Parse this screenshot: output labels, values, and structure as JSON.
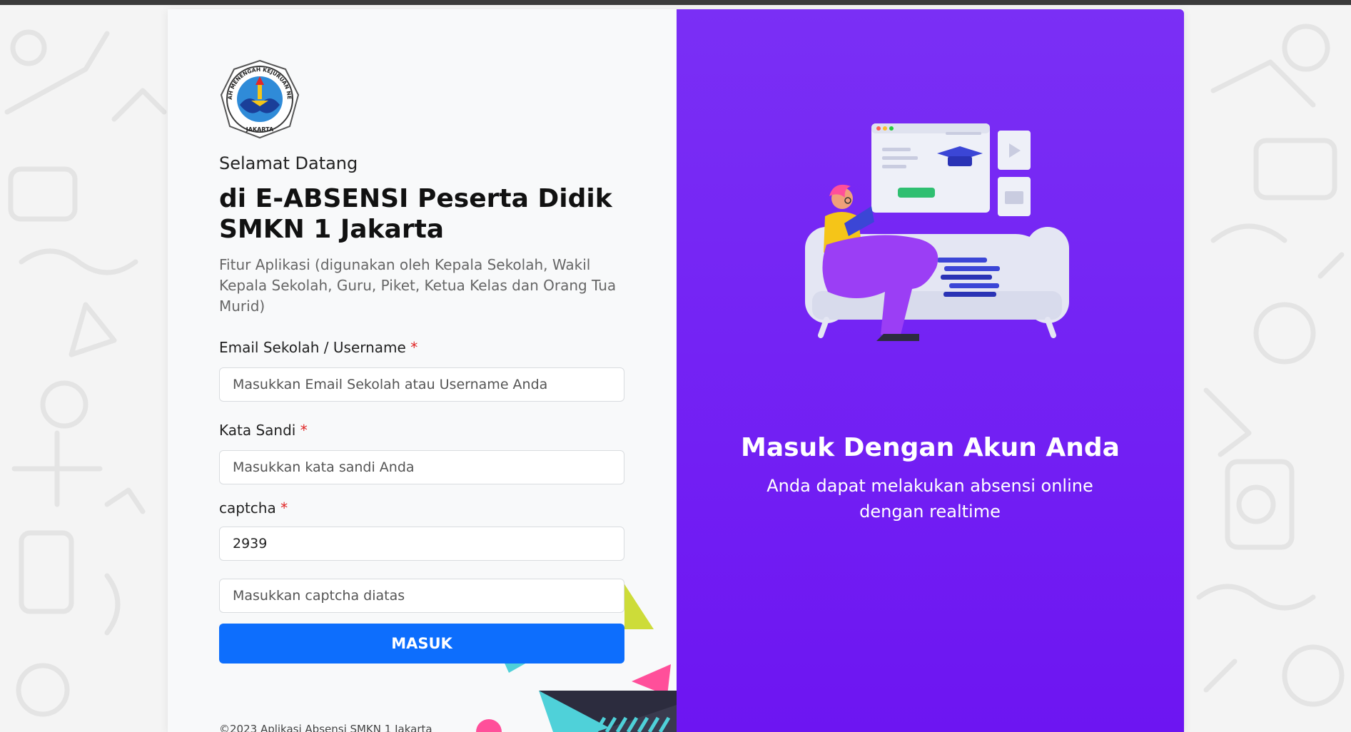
{
  "logo": {
    "ring_text": "SEKOLAH MENENGAH KEJURUAN NEGERI 1",
    "bottom_text": "JAKARTA"
  },
  "login": {
    "welcome": "Selamat Datang",
    "title_line1": "di E-ABSENSI Peserta Didik",
    "title_line2": "SMKN 1 Jakarta",
    "subtitle": "Fitur Aplikasi (digunakan oleh Kepala Sekolah, Wakil Kepala Sekolah, Guru, Piket, Ketua Kelas dan Orang Tua Murid)",
    "required_mark": "*",
    "email_label": "Email Sekolah / Username",
    "email_placeholder": "Masukkan Email Sekolah atau Username Anda",
    "password_label": "Kata Sandi",
    "password_placeholder": "Masukkan kata sandi Anda",
    "captcha_label": "captcha",
    "captcha_value": "2939",
    "captcha_placeholder": "Masukkan captcha diatas",
    "submit_label": "MASUK",
    "footer": "©2023 Aplikasi Absensi SMKN 1 Jakarta"
  },
  "promo": {
    "heading": "Masuk Dengan Akun Anda",
    "description": "Anda dapat melakukan absensi online dengan realtime"
  },
  "colors": {
    "primary_button": "#0d6efd",
    "promo_background": "#7126f4",
    "required": "#e02424"
  }
}
